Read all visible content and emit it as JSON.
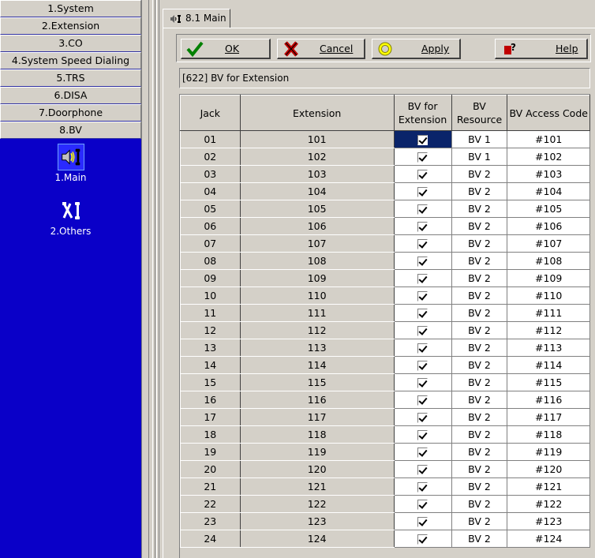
{
  "nav": {
    "items": [
      {
        "label": "1.System"
      },
      {
        "label": "2.Extension"
      },
      {
        "label": "3.CO"
      },
      {
        "label": "4.System Speed Dialing"
      },
      {
        "label": "5.TRS"
      },
      {
        "label": "6.DISA"
      },
      {
        "label": "7.Doorphone"
      },
      {
        "label": "8.BV"
      }
    ],
    "sub_items": [
      {
        "label": "1.Main",
        "icon": "speaker-phone-icon"
      },
      {
        "label": "2.Others",
        "icon": "tools-phone-icon"
      }
    ]
  },
  "tab": {
    "label": "8.1 Main",
    "icon": "speaker-phone-icon"
  },
  "toolbar": {
    "ok_label": "OK",
    "cancel_label": "Cancel",
    "apply_label": "Apply",
    "help_label": "Help"
  },
  "section": {
    "title": "[622] BV for Extension"
  },
  "grid": {
    "headers": {
      "jack": "Jack",
      "extension": "Extension",
      "bv_for_extension": "BV for Extension",
      "bv_resource": "BV Resource",
      "bv_access_code": "BV Access Code"
    },
    "rows": [
      {
        "jack": "01",
        "extension": "101",
        "checked": true,
        "resource": "BV 1",
        "code": "#101"
      },
      {
        "jack": "02",
        "extension": "102",
        "checked": true,
        "resource": "BV 1",
        "code": "#102"
      },
      {
        "jack": "03",
        "extension": "103",
        "checked": true,
        "resource": "BV 2",
        "code": "#103"
      },
      {
        "jack": "04",
        "extension": "104",
        "checked": true,
        "resource": "BV 2",
        "code": "#104"
      },
      {
        "jack": "05",
        "extension": "105",
        "checked": true,
        "resource": "BV 2",
        "code": "#105"
      },
      {
        "jack": "06",
        "extension": "106",
        "checked": true,
        "resource": "BV 2",
        "code": "#106"
      },
      {
        "jack": "07",
        "extension": "107",
        "checked": true,
        "resource": "BV 2",
        "code": "#107"
      },
      {
        "jack": "08",
        "extension": "108",
        "checked": true,
        "resource": "BV 2",
        "code": "#108"
      },
      {
        "jack": "09",
        "extension": "109",
        "checked": true,
        "resource": "BV 2",
        "code": "#109"
      },
      {
        "jack": "10",
        "extension": "110",
        "checked": true,
        "resource": "BV 2",
        "code": "#110"
      },
      {
        "jack": "11",
        "extension": "111",
        "checked": true,
        "resource": "BV 2",
        "code": "#111"
      },
      {
        "jack": "12",
        "extension": "112",
        "checked": true,
        "resource": "BV 2",
        "code": "#112"
      },
      {
        "jack": "13",
        "extension": "113",
        "checked": true,
        "resource": "BV 2",
        "code": "#113"
      },
      {
        "jack": "14",
        "extension": "114",
        "checked": true,
        "resource": "BV 2",
        "code": "#114"
      },
      {
        "jack": "15",
        "extension": "115",
        "checked": true,
        "resource": "BV 2",
        "code": "#115"
      },
      {
        "jack": "16",
        "extension": "116",
        "checked": true,
        "resource": "BV 2",
        "code": "#116"
      },
      {
        "jack": "17",
        "extension": "117",
        "checked": true,
        "resource": "BV 2",
        "code": "#117"
      },
      {
        "jack": "18",
        "extension": "118",
        "checked": true,
        "resource": "BV 2",
        "code": "#118"
      },
      {
        "jack": "19",
        "extension": "119",
        "checked": true,
        "resource": "BV 2",
        "code": "#119"
      },
      {
        "jack": "20",
        "extension": "120",
        "checked": true,
        "resource": "BV 2",
        "code": "#120"
      },
      {
        "jack": "21",
        "extension": "121",
        "checked": true,
        "resource": "BV 2",
        "code": "#121"
      },
      {
        "jack": "22",
        "extension": "122",
        "checked": true,
        "resource": "BV 2",
        "code": "#122"
      },
      {
        "jack": "23",
        "extension": "123",
        "checked": true,
        "resource": "BV 2",
        "code": "#123"
      },
      {
        "jack": "24",
        "extension": "124",
        "checked": true,
        "resource": "BV 2",
        "code": "#124"
      }
    ]
  },
  "colors": {
    "sidebar_bg": "#0a00c8",
    "window_bg": "#d4d0c8",
    "selection": "#0a246a"
  }
}
